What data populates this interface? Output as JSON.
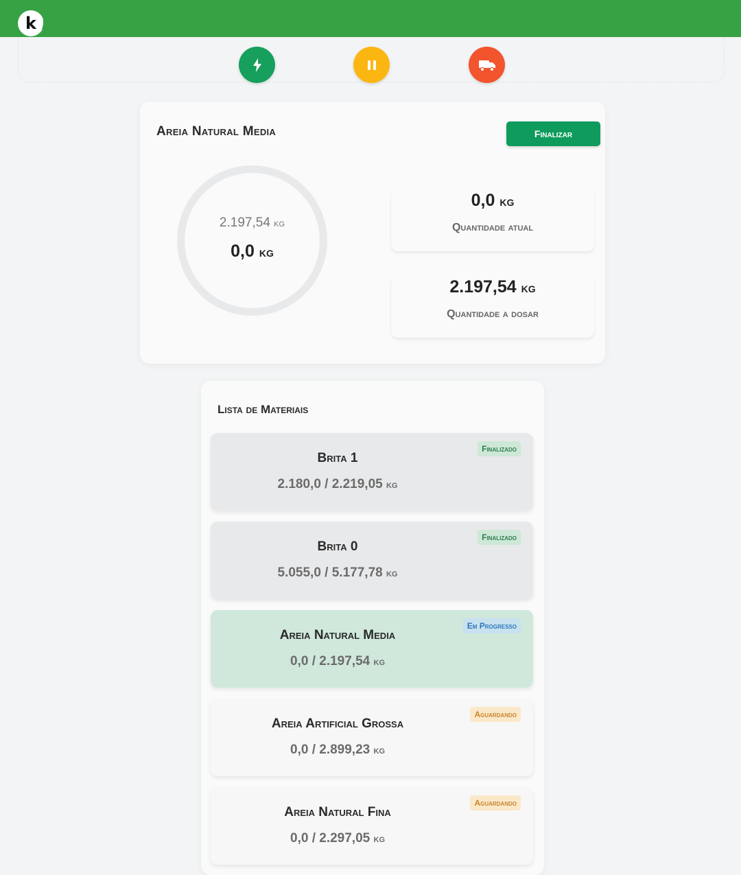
{
  "app": {
    "logo_letter": "k"
  },
  "toolbar": {
    "buttons": [
      {
        "name": "power",
        "color": "#17a05d"
      },
      {
        "name": "pause",
        "color": "#fbb612"
      },
      {
        "name": "truck",
        "color": "#f2542d"
      }
    ]
  },
  "main": {
    "title": "Areia Natural Media",
    "finalize_label": "Finalizar",
    "gauge": {
      "target_value": "2.197,54",
      "target_unit": "kg",
      "current_value": "0,0",
      "current_unit": "kg",
      "progress": 0
    },
    "current_qty": {
      "value": "0,0",
      "unit": "kg",
      "label": "Quantidade atual"
    },
    "dose_qty": {
      "value": "2.197,54",
      "unit": "kg",
      "label": "Quantidade a dosar"
    }
  },
  "materials": {
    "title": "Lista de Materiais",
    "items": [
      {
        "name": "Brita 1",
        "qty": "2.180,0 / 2.219,05",
        "unit": "kg",
        "status": "Finalizado",
        "state": "done"
      },
      {
        "name": "Brita 0",
        "qty": "5.055,0 / 5.177,78",
        "unit": "kg",
        "status": "Finalizado",
        "state": "done"
      },
      {
        "name": "Areia Natural Media",
        "qty": "0,0 / 2.197,54",
        "unit": "kg",
        "status": "Em Progresso",
        "state": "progress"
      },
      {
        "name": "Areia Artificial Grossa",
        "qty": "0,0 / 2.899,23",
        "unit": "kg",
        "status": "Aguardando",
        "state": "wait"
      },
      {
        "name": "Areia Natural Fina",
        "qty": "0,0 / 2.297,05",
        "unit": "kg",
        "status": "Aguardando",
        "state": "wait"
      }
    ]
  },
  "colors": {
    "topbar": "#37a244",
    "finalize": "#0f9b5c",
    "in_progress_bg": "#cfe8db"
  }
}
